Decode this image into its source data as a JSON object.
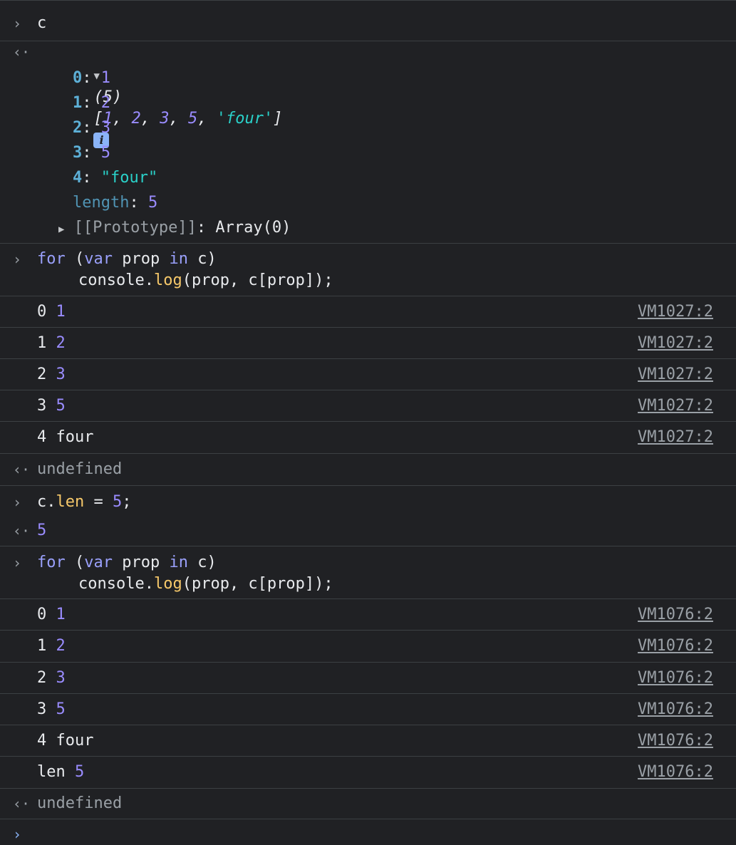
{
  "entry1": {
    "input": "c",
    "summary_count": "(5)",
    "summary_open": "[",
    "summary_items": [
      "1",
      "2",
      "3",
      "5",
      "'four'"
    ],
    "summary_close": "]",
    "items": [
      {
        "key": "0",
        "value": "1"
      },
      {
        "key": "1",
        "value": "2"
      },
      {
        "key": "2",
        "value": "3"
      },
      {
        "key": "3",
        "value": "5"
      },
      {
        "key": "4",
        "value": "\"four\""
      }
    ],
    "length_key": "length",
    "length_value": "5",
    "prototype_label": "[[Prototype]]",
    "prototype_value": "Array(0)"
  },
  "code1": {
    "line1": {
      "kw1": "for",
      "p1": " (",
      "kw2": "var",
      "mid": " prop ",
      "kw3": "in",
      "tail": " c)"
    },
    "line2": {
      "obj": "console.",
      "fn": "log",
      "tail": "(prop, c[prop]);"
    }
  },
  "logs1": [
    {
      "a": "0",
      "b": "1",
      "src": "VM1027:2"
    },
    {
      "a": "1",
      "b": "2",
      "src": "VM1027:2"
    },
    {
      "a": "2",
      "b": "3",
      "src": "VM1027:2"
    },
    {
      "a": "3",
      "b": "5",
      "src": "VM1027:2"
    },
    {
      "a": "4",
      "b": "four",
      "src": "VM1027:2"
    }
  ],
  "result1": "undefined",
  "assign": {
    "obj": "c.",
    "prop": "len",
    "op": " = ",
    "val": "5",
    "semi": ";"
  },
  "assign_result": "5",
  "code2": {
    "line1": {
      "kw1": "for",
      "p1": " (",
      "kw2": "var",
      "mid": " prop ",
      "kw3": "in",
      "tail": " c)"
    },
    "line2": {
      "obj": "console.",
      "fn": "log",
      "tail": "(prop, c[prop]);"
    }
  },
  "logs2": [
    {
      "a": "0",
      "b": "1",
      "src": "VM1076:2"
    },
    {
      "a": "1",
      "b": "2",
      "src": "VM1076:2"
    },
    {
      "a": "2",
      "b": "3",
      "src": "VM1076:2"
    },
    {
      "a": "3",
      "b": "5",
      "src": "VM1076:2"
    },
    {
      "a": "4",
      "b": "four",
      "src": "VM1076:2"
    },
    {
      "a": "len",
      "b": "5",
      "src": "VM1076:2"
    }
  ],
  "result2": "undefined",
  "glyphs": {
    "input": "›",
    "output": "‹·",
    "expand_down": "▼",
    "expand_right": "▶",
    "info": "i"
  }
}
